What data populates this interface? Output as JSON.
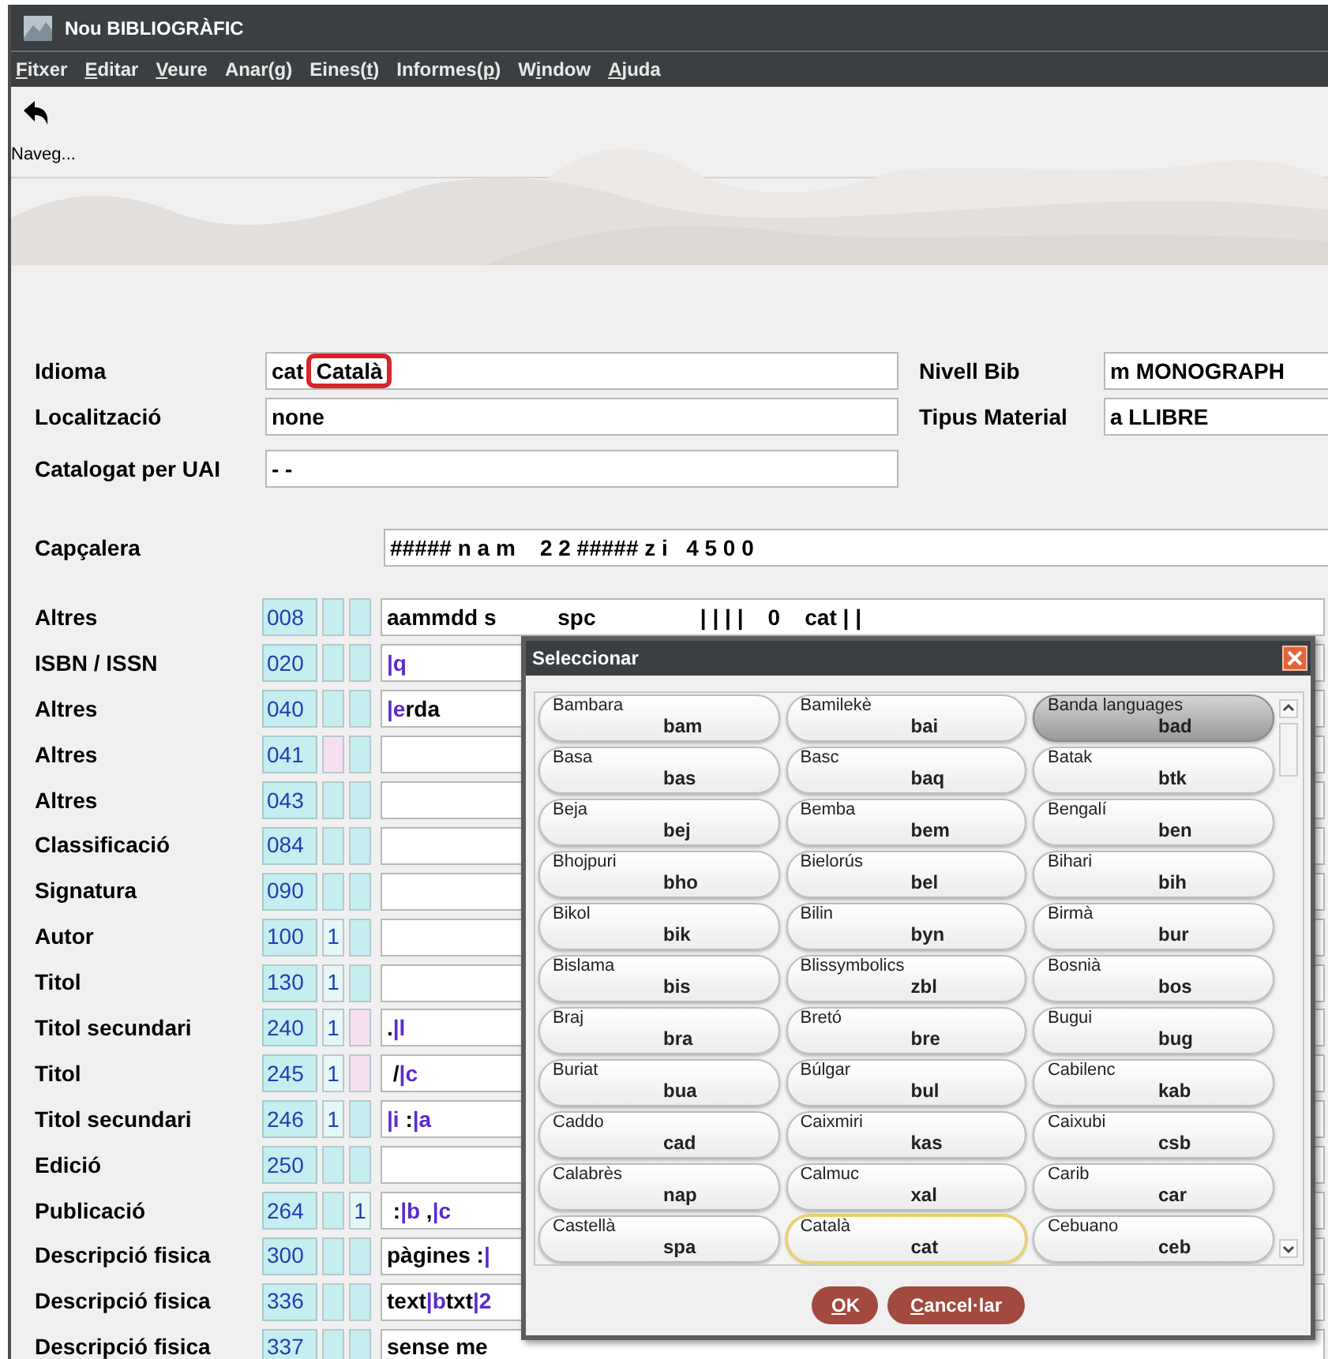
{
  "window": {
    "title": "Nou BIBLIOGRÀFIC"
  },
  "menu": [
    {
      "key": "F",
      "post": "itxer"
    },
    {
      "key": "E",
      "post": "ditar"
    },
    {
      "key": "V",
      "post": "eure"
    },
    {
      "pre": "Anar(",
      "key": "g",
      "post": ")"
    },
    {
      "pre": "Eines(",
      "key": "t",
      "post": ")"
    },
    {
      "pre": "Informes(",
      "key": "p",
      "post": ")"
    },
    {
      "pre": "W",
      "key": "i",
      "post": "ndow"
    },
    {
      "key": "A",
      "post": "juda"
    }
  ],
  "toolbar": [
    {
      "label": "Naveg..."
    }
  ],
  "header_fields": {
    "idioma": {
      "label": "Idioma",
      "code": "cat",
      "name": "Català",
      "annotated": true
    },
    "localitzacio": {
      "label": "Localització",
      "value": "none"
    },
    "catalogat": {
      "label": "Catalogat per UAI",
      "value": "- -"
    },
    "nivell_bib": {
      "label": "Nivell Bib",
      "value": "m MONOGRAPH"
    },
    "tipus_material": {
      "label": "Tipus Material",
      "value": "a LLIBRE"
    },
    "capcalera": {
      "label": "Capçalera",
      "value": "##### n a m    2 2 ##### z i   4 5 0 0"
    }
  },
  "fields": [
    {
      "label": "Altres",
      "tag": "008",
      "ind1": {
        "color": "#c4eef0"
      },
      "ind2": {
        "color": "#c4eef0"
      },
      "value": [
        {
          "text": "aammdd s          spc                 | | | |    0    cat | |",
          "kind": "plain"
        }
      ]
    },
    {
      "label": "ISBN / ISSN",
      "tag": "020",
      "ind1": {
        "color": "#c4eef0"
      },
      "ind2": {
        "color": "#c4eef0"
      },
      "value": [
        {
          "text": "|q",
          "kind": "subfield"
        }
      ]
    },
    {
      "label": "Altres",
      "tag": "040",
      "ind1": {
        "color": "#c4eef0"
      },
      "ind2": {
        "color": "#c4eef0"
      },
      "value": [
        {
          "text": "|e",
          "kind": "subfield"
        },
        {
          "text": "rda",
          "kind": "plain"
        }
      ]
    },
    {
      "label": "Altres",
      "tag": "041",
      "ind1": {
        "color": "#f7dff2"
      },
      "ind2": {
        "color": "#c4eef0"
      }
    },
    {
      "label": "Altres",
      "tag": "043",
      "ind1": {
        "color": "#c4eef0"
      },
      "ind2": {
        "color": "#c4eef0"
      }
    },
    {
      "label": "Classificació",
      "tag": "084",
      "ind1": {
        "color": "#c4eef0"
      },
      "ind2": {
        "color": "#c4eef0"
      }
    },
    {
      "label": "Signatura",
      "tag": "090",
      "ind1": {
        "color": "#c4eef0"
      },
      "ind2": {
        "color": "#c4eef0"
      }
    },
    {
      "label": "Autor",
      "tag": "100",
      "ind1": {
        "text": "1",
        "color": "#e6f7f8"
      },
      "ind2": {
        "color": "#c4eef0"
      }
    },
    {
      "label": "Titol",
      "tag": "130",
      "ind1": {
        "text": "1",
        "color": "#e6f7f8"
      },
      "ind2": {
        "color": "#c4eef0"
      }
    },
    {
      "label": "Titol secundari",
      "tag": "240",
      "ind1": {
        "text": "1",
        "color": "#e6f7f8"
      },
      "ind2": {
        "color": "#f7dff2"
      },
      "value": [
        {
          "text": ".",
          "kind": "plain"
        },
        {
          "text": "|l",
          "kind": "subfield"
        }
      ]
    },
    {
      "label": "Titol",
      "tag": "245",
      "ind1": {
        "text": "1",
        "color": "#e6f7f8"
      },
      "ind2": {
        "color": "#f7dff2"
      },
      "value": [
        {
          "text": " /",
          "kind": "plain"
        },
        {
          "text": "|c",
          "kind": "subfield"
        }
      ]
    },
    {
      "label": "Titol secundari",
      "tag": "246",
      "ind1": {
        "text": "1",
        "color": "#e6f7f8"
      },
      "ind2": {
        "color": "#c4eef0"
      },
      "value": [
        {
          "text": "|i",
          "kind": "subfield"
        },
        {
          "text": " :",
          "kind": "plain"
        },
        {
          "text": "|a",
          "kind": "subfield"
        }
      ]
    },
    {
      "label": "Edició",
      "tag": "250",
      "ind1": {
        "color": "#c4eef0"
      },
      "ind2": {
        "color": "#c4eef0"
      }
    },
    {
      "label": "Publicació",
      "tag": "264",
      "ind1": {
        "color": "#c4eef0"
      },
      "ind2": {
        "text": "1",
        "color": "#e6f7f8"
      },
      "value": [
        {
          "text": " :",
          "kind": "plain"
        },
        {
          "text": "|b",
          "kind": "subfield"
        },
        {
          "text": " ,",
          "kind": "plain"
        },
        {
          "text": "|c",
          "kind": "subfield"
        }
      ]
    },
    {
      "label": "Descripció fisica",
      "tag": "300",
      "ind1": {
        "color": "#c4eef0"
      },
      "ind2": {
        "color": "#c4eef0"
      },
      "value": [
        {
          "text": "pàgines :",
          "kind": "plain"
        },
        {
          "text": "|",
          "kind": "subfield"
        }
      ]
    },
    {
      "label": "Descripció fisica",
      "tag": "336",
      "ind1": {
        "color": "#c4eef0"
      },
      "ind2": {
        "color": "#c4eef0"
      },
      "value": [
        {
          "text": "text",
          "kind": "plain"
        },
        {
          "text": "|b",
          "kind": "subfield"
        },
        {
          "text": "txt",
          "kind": "plain"
        },
        {
          "text": "|2",
          "kind": "subfield"
        }
      ]
    },
    {
      "label": "Descripció fisica",
      "tag": "337",
      "ind1": {
        "color": "#c4eef0"
      },
      "ind2": {
        "color": "#c4eef0"
      },
      "value": [
        {
          "text": "sense me",
          "kind": "plain"
        }
      ]
    }
  ],
  "dialog": {
    "title": "Seleccionar",
    "options": [
      {
        "name": "Bambara",
        "code": "bam",
        "pressed": false,
        "focused": false
      },
      {
        "name": "Bamilekè",
        "code": "bai",
        "pressed": false,
        "focused": false
      },
      {
        "name": "Banda languages",
        "code": "bad",
        "pressed": true,
        "focused": false
      },
      {
        "name": "Basa",
        "code": "bas",
        "pressed": false,
        "focused": false
      },
      {
        "name": "Basc",
        "code": "baq",
        "pressed": false,
        "focused": false
      },
      {
        "name": "Batak",
        "code": "btk",
        "pressed": false,
        "focused": false
      },
      {
        "name": "Beja",
        "code": "bej",
        "pressed": false,
        "focused": false
      },
      {
        "name": "Bemba",
        "code": "bem",
        "pressed": false,
        "focused": false
      },
      {
        "name": "Bengalí",
        "code": "ben",
        "pressed": false,
        "focused": false
      },
      {
        "name": "Bhojpuri",
        "code": "bho",
        "pressed": false,
        "focused": false
      },
      {
        "name": "Bielorús",
        "code": "bel",
        "pressed": false,
        "focused": false
      },
      {
        "name": "Bihari",
        "code": "bih",
        "pressed": false,
        "focused": false
      },
      {
        "name": "Bikol",
        "code": "bik",
        "pressed": false,
        "focused": false
      },
      {
        "name": "Bilin",
        "code": "byn",
        "pressed": false,
        "focused": false
      },
      {
        "name": "Birmà",
        "code": "bur",
        "pressed": false,
        "focused": false
      },
      {
        "name": "Bislama",
        "code": "bis",
        "pressed": false,
        "focused": false
      },
      {
        "name": "Blissymbolics",
        "code": "zbl",
        "pressed": false,
        "focused": false
      },
      {
        "name": "Bosnià",
        "code": "bos",
        "pressed": false,
        "focused": false
      },
      {
        "name": "Braj",
        "code": "bra",
        "pressed": false,
        "focused": false
      },
      {
        "name": "Bretó",
        "code": "bre",
        "pressed": false,
        "focused": false
      },
      {
        "name": "Bugui",
        "code": "bug",
        "pressed": false,
        "focused": false
      },
      {
        "name": "Buriat",
        "code": "bua",
        "pressed": false,
        "focused": false
      },
      {
        "name": "Búlgar",
        "code": "bul",
        "pressed": false,
        "focused": false
      },
      {
        "name": "Cabilenc",
        "code": "kab",
        "pressed": false,
        "focused": false
      },
      {
        "name": "Caddo",
        "code": "cad",
        "pressed": false,
        "focused": false
      },
      {
        "name": "Caixmiri",
        "code": "kas",
        "pressed": false,
        "focused": false
      },
      {
        "name": "Caixubi",
        "code": "csb",
        "pressed": false,
        "focused": false
      },
      {
        "name": "Calabrès",
        "code": "nap",
        "pressed": false,
        "focused": false
      },
      {
        "name": "Calmuc",
        "code": "xal",
        "pressed": false,
        "focused": false
      },
      {
        "name": "Carib",
        "code": "car",
        "pressed": false,
        "focused": false
      },
      {
        "name": "Castellà",
        "code": "spa",
        "pressed": false,
        "focused": false
      },
      {
        "name": "Català",
        "code": "cat",
        "pressed": false,
        "focused": true
      },
      {
        "name": "Cebuano",
        "code": "ceb",
        "pressed": false,
        "focused": false
      }
    ],
    "buttons": [
      {
        "key": "O",
        "post": "K"
      },
      {
        "key": "C",
        "post": "ancel·lar"
      }
    ]
  }
}
